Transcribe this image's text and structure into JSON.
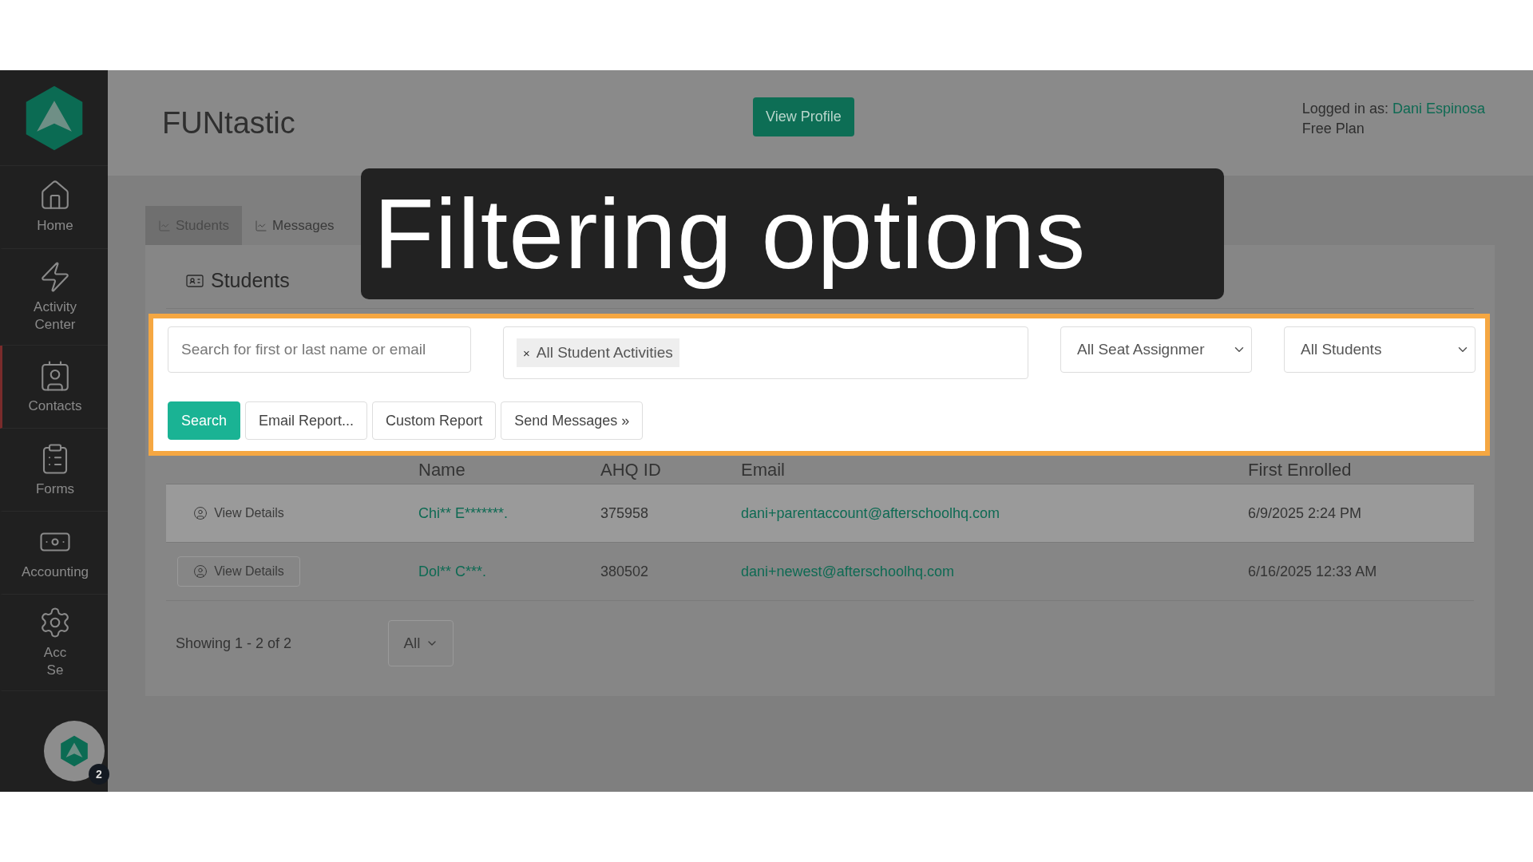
{
  "sidebar": {
    "items": [
      {
        "kind": "home",
        "lines": [
          "Home"
        ],
        "selected": false
      },
      {
        "kind": "activity",
        "lines": [
          "Activity",
          "Center"
        ],
        "selected": false
      },
      {
        "kind": "contacts",
        "lines": [
          "Contacts"
        ],
        "selected": true
      },
      {
        "kind": "forms",
        "lines": [
          "Forms"
        ],
        "selected": false
      },
      {
        "kind": "accounting",
        "lines": [
          "Accounting"
        ],
        "selected": false
      },
      {
        "kind": "settings",
        "lines": [
          "Acc",
          "Se"
        ],
        "selected": false
      }
    ],
    "chat_badge": "2"
  },
  "header": {
    "title": "FUNtastic",
    "button": "View Profile",
    "logged_in_label": "Logged in as:",
    "user": "Dani Espinosa",
    "plan": "Free Plan"
  },
  "tabs": [
    {
      "label": "Students",
      "selected": true
    },
    {
      "label": "Messages",
      "selected": false
    }
  ],
  "caption": "Filtering options",
  "panel": {
    "title": "Students",
    "filters": {
      "search_placeholder": "Search for first or last name or email",
      "activity_tag": "All Student Activities",
      "tag_remove": "×",
      "seat_select": "All Seat Assignmer",
      "students_select": "All Students"
    },
    "buttons": [
      {
        "label": "Search",
        "kind": "primary"
      },
      {
        "label": "Email Report...",
        "kind": "default"
      },
      {
        "label": "Custom Report",
        "kind": "default"
      },
      {
        "label": "Send Messages »",
        "kind": "default"
      }
    ],
    "table": {
      "columns": [
        "Name",
        "AHQ ID",
        "Email",
        "First Enrolled"
      ],
      "rows": [
        {
          "action": "View Details",
          "name": "Chi** E*******.",
          "id": "375958",
          "email": "dani+parentaccount@afterschoolhq.com",
          "enrolled": "6/9/2025 2:24 PM",
          "selected": true
        },
        {
          "action": "View Details",
          "name": "Dol** C***.",
          "id": "380502",
          "email": "dani+newest@afterschoolhq.com",
          "enrolled": "6/16/2025 12:33 AM",
          "selected": false
        }
      ]
    },
    "footer": {
      "showing": "Showing 1 - 2 of 2",
      "page_size": "All"
    }
  }
}
